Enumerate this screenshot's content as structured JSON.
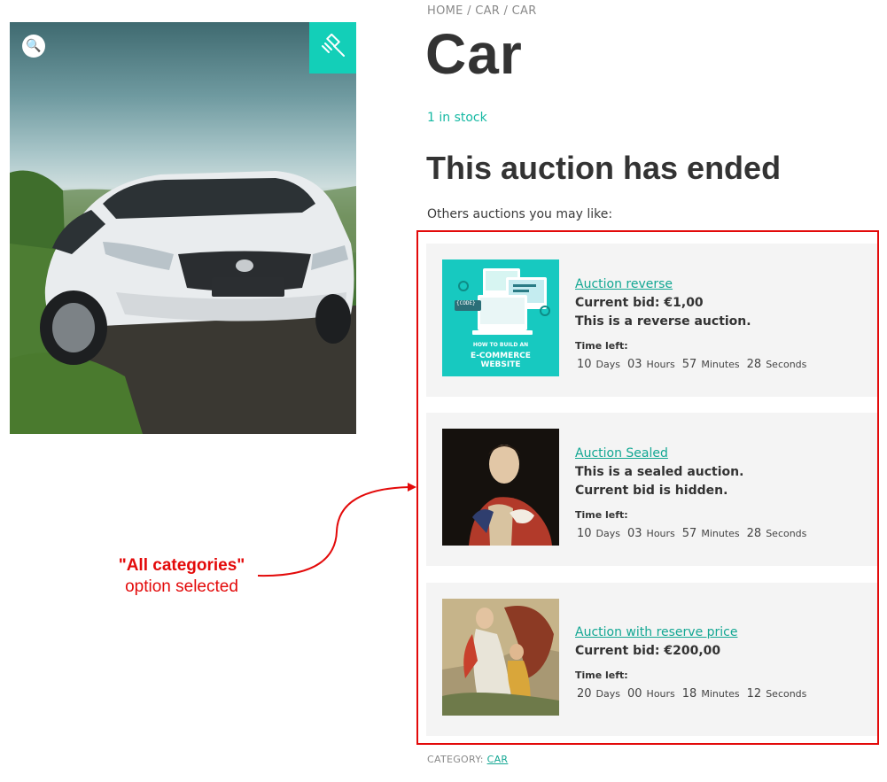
{
  "breadcrumb": {
    "items": [
      "HOME",
      "CAR",
      "CAR"
    ],
    "separator": "/"
  },
  "product": {
    "title": "Car",
    "stock": "1 in stock",
    "image_icon": "car-photo",
    "zoom_icon": "magnifier-icon",
    "badge_icon": "gavel-icon"
  },
  "auction": {
    "ended_heading": "This auction has ended",
    "others_label": "Others auctions you may like:"
  },
  "cards": [
    {
      "title": "Auction reverse",
      "lines": [
        "Current bid: €1,00",
        "This is a reverse auction."
      ],
      "time_left_label": "Time left:",
      "countdown": [
        {
          "value": "10",
          "unit": "Days"
        },
        {
          "value": "03",
          "unit": "Hours"
        },
        {
          "value": "57",
          "unit": "Minutes"
        },
        {
          "value": "28",
          "unit": "Seconds"
        }
      ],
      "thumb_text": [
        "{CODE}",
        "HOW TO BUILD AN",
        "E-COMMERCE",
        "WEBSITE"
      ]
    },
    {
      "title": "Auction Sealed",
      "lines": [
        "This is a sealed auction.",
        "Current bid is hidden."
      ],
      "time_left_label": "Time left:",
      "countdown": [
        {
          "value": "10",
          "unit": "Days"
        },
        {
          "value": "03",
          "unit": "Hours"
        },
        {
          "value": "57",
          "unit": "Minutes"
        },
        {
          "value": "28",
          "unit": "Seconds"
        }
      ]
    },
    {
      "title": "Auction with reserve price",
      "lines": [
        "Current bid: €200,00"
      ],
      "time_left_label": "Time left:",
      "countdown": [
        {
          "value": "20",
          "unit": "Days"
        },
        {
          "value": "00",
          "unit": "Hours"
        },
        {
          "value": "18",
          "unit": "Minutes"
        },
        {
          "value": "12",
          "unit": "Seconds"
        }
      ]
    }
  ],
  "category": {
    "label": "CATEGORY:",
    "value": "CAR"
  },
  "annotation": {
    "strong": "\"All categories\"",
    "light": "option selected",
    "color": "#e30a0a"
  },
  "colors": {
    "accent": "#13cfb8",
    "link": "#13a793",
    "highlight": "#e30a0a"
  }
}
